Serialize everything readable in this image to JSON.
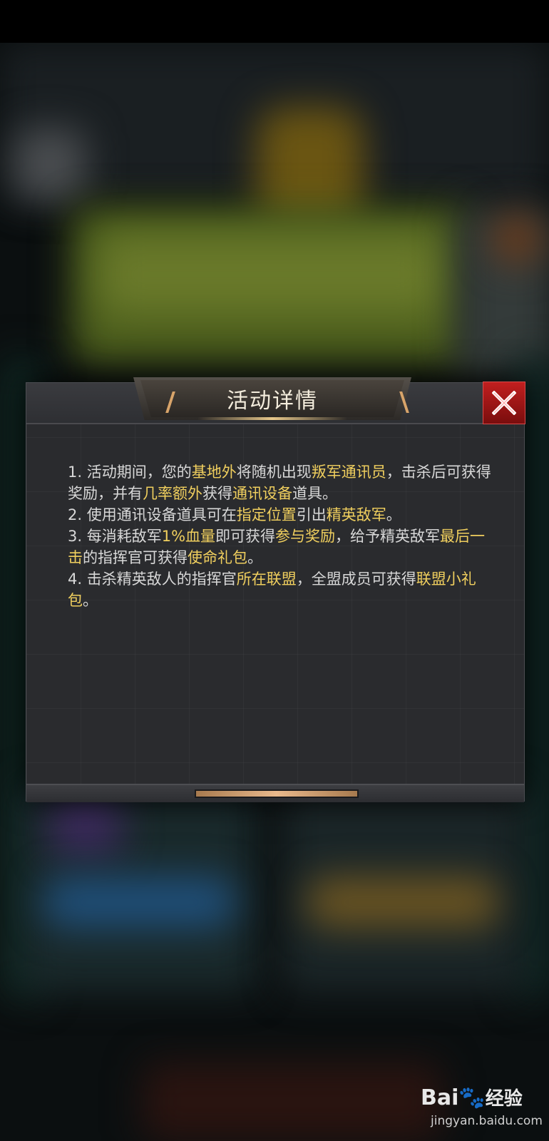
{
  "dialog": {
    "title": "活动详情",
    "close_label": "close",
    "items": [
      [
        {
          "t": "1. 活动期间，您的",
          "h": false
        },
        {
          "t": "基地外",
          "h": true
        },
        {
          "t": "将随机出现",
          "h": false
        },
        {
          "t": "叛军通讯员",
          "h": true
        },
        {
          "t": "，击杀后可获得奖励，并有",
          "h": false
        },
        {
          "t": "几率额外",
          "h": true
        },
        {
          "t": "获得",
          "h": false
        },
        {
          "t": "通讯设备",
          "h": true
        },
        {
          "t": "道具。",
          "h": false
        }
      ],
      [
        {
          "t": "2. 使用通讯设备道具可在",
          "h": false
        },
        {
          "t": "指定位置",
          "h": true
        },
        {
          "t": "引出",
          "h": false
        },
        {
          "t": "精英敌军",
          "h": true
        },
        {
          "t": "。",
          "h": false
        }
      ],
      [
        {
          "t": "3. 每消耗敌军",
          "h": false
        },
        {
          "t": "1%血量",
          "h": true
        },
        {
          "t": "即可获得",
          "h": false
        },
        {
          "t": "参与奖励",
          "h": true
        },
        {
          "t": "，给予精英敌军",
          "h": false
        },
        {
          "t": "最后一击",
          "h": true
        },
        {
          "t": "的指挥官可获得",
          "h": false
        },
        {
          "t": "使命礼包",
          "h": true
        },
        {
          "t": "。",
          "h": false
        }
      ],
      [
        {
          "t": "4. 击杀精英敌人的指挥官",
          "h": false
        },
        {
          "t": "所在联盟",
          "h": true
        },
        {
          "t": "，全盟成员可获得",
          "h": false
        },
        {
          "t": "联盟小礼包",
          "h": true
        },
        {
          "t": "。",
          "h": false
        }
      ]
    ]
  },
  "watermark": {
    "logo": "Bai",
    "paw": "🐾",
    "cn": "经验",
    "url": "jingyan.baidu.com"
  },
  "colors": {
    "highlight": "#f0cf5e",
    "body_text": "#d8d8d8",
    "close_red": "#c11f1f"
  }
}
